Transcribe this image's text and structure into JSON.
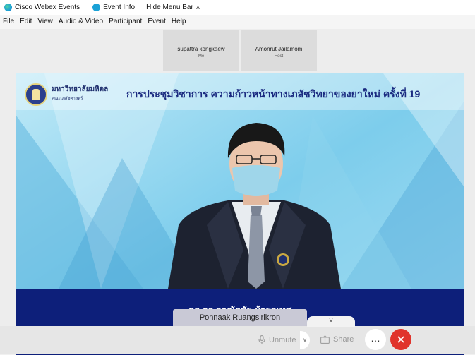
{
  "titlebar": {
    "app_name": "Cisco Webex Events",
    "event_info": "Event Info",
    "hide_menu": "Hide Menu Bar",
    "brand_color": "#1aa1d6"
  },
  "menubar": {
    "items": [
      "File",
      "Edit",
      "View",
      "Audio & Video",
      "Participant",
      "Event",
      "Help"
    ]
  },
  "participants": [
    {
      "name": "supattra kongkaew",
      "role": "Me"
    },
    {
      "name": "Amonrut Jailamom",
      "role": "Host"
    }
  ],
  "video": {
    "university_name": "มหาวิทยาลัยมหิดล",
    "faculty": "คณะเภสัชศาสตร์",
    "conference_title": "การประชุมวิชาการ ความก้าวหน้าทางเภสัชวิทยาของยาใหม่ ครั้งที่ 19",
    "speaker_caption": "ดร.ภก.อาณัฐชัย ม้ายอเทศ",
    "active_speaker": "Ponnaak Ruangsirikron"
  },
  "controls": {
    "unmute": "Unmute",
    "share": "Share",
    "more": "…",
    "leave_color": "#e0342c"
  }
}
